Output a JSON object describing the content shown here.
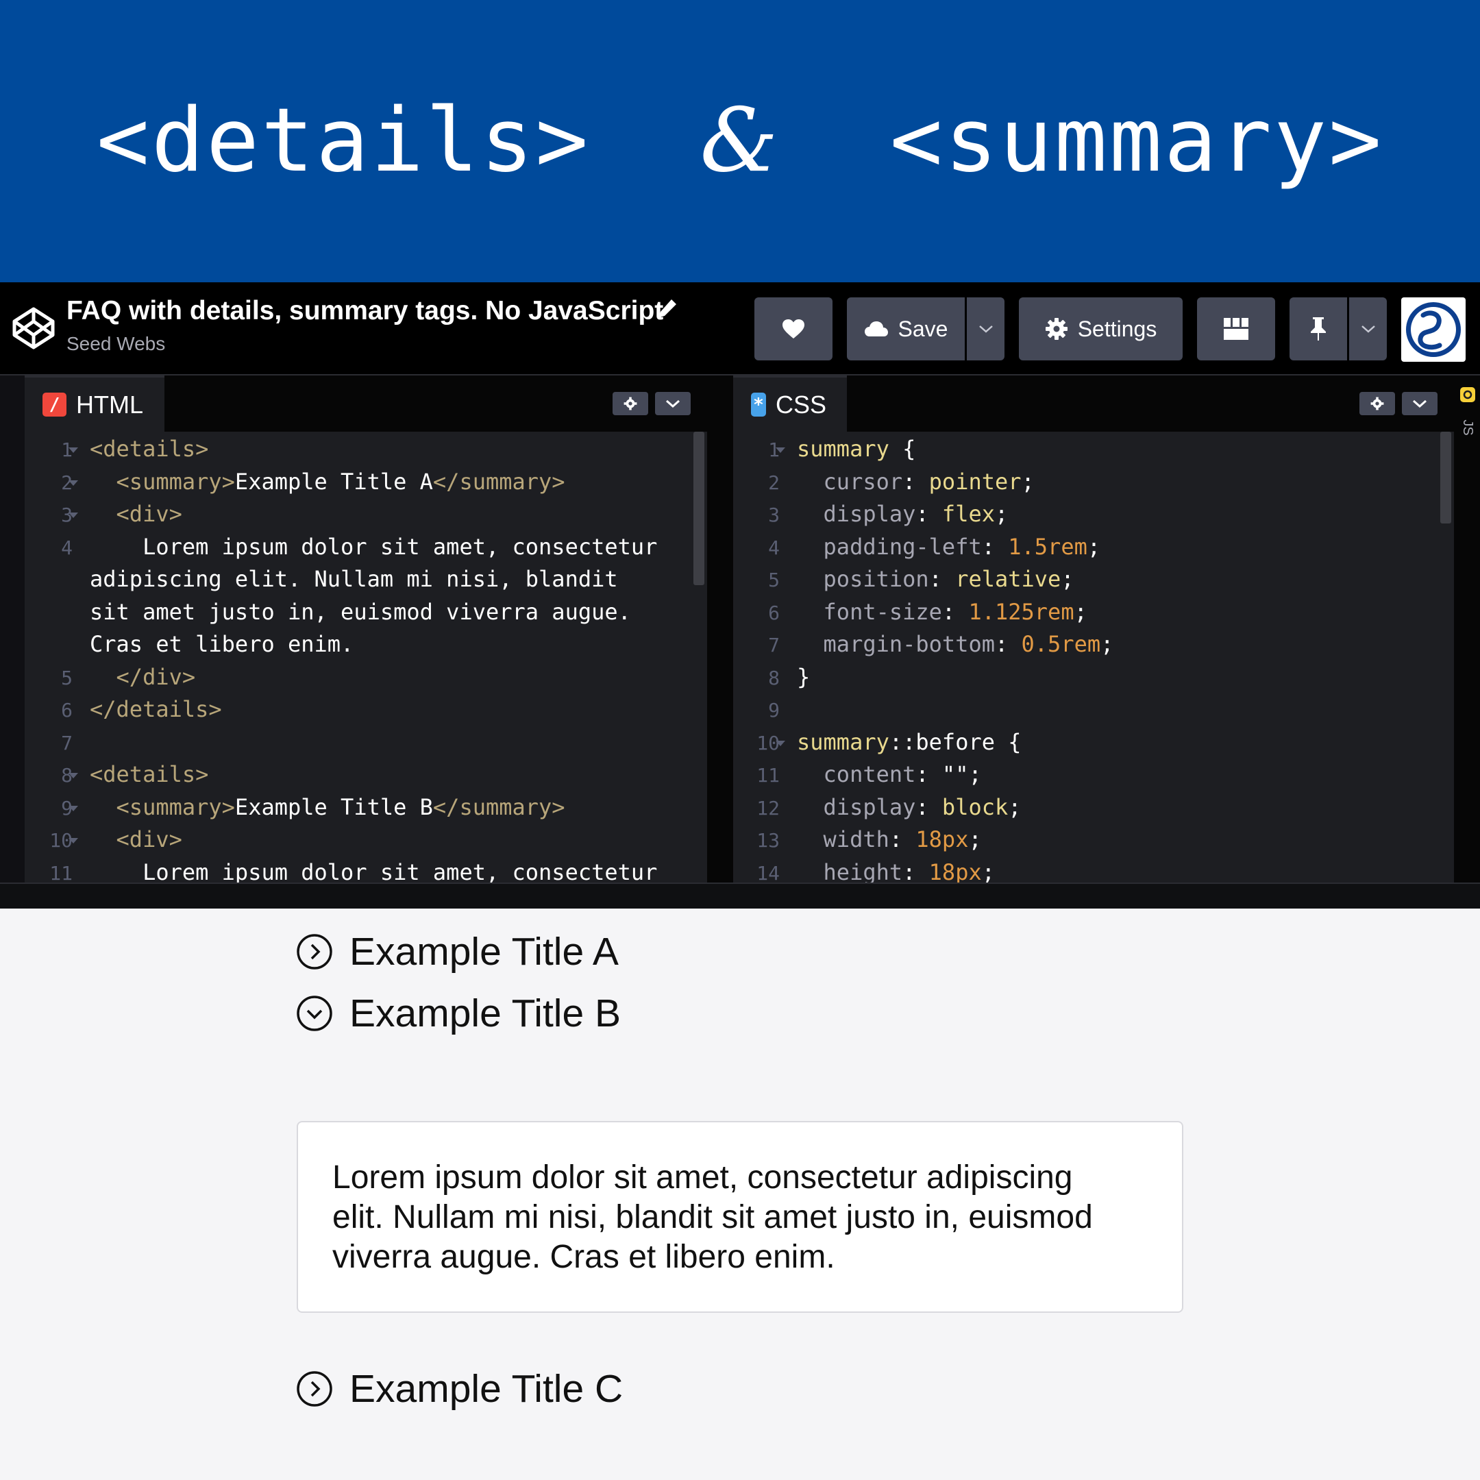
{
  "banner": {
    "left": "<details>",
    "amp": "&",
    "right": "<summary>"
  },
  "header": {
    "title": "FAQ with details, summary tags. No JavaScript",
    "author": "Seed Webs",
    "save_label": "Save",
    "settings_label": "Settings"
  },
  "html_panel": {
    "tab_label": "HTML",
    "lines": [
      {
        "n": "1",
        "fold": true,
        "segs": [
          [
            "c-tag",
            "<details>"
          ]
        ]
      },
      {
        "n": "2",
        "fold": true,
        "segs": [
          [
            "c-tag",
            "  <summary>"
          ],
          [
            "c-txt",
            "Example Title A"
          ],
          [
            "c-tag",
            "</summary>"
          ]
        ]
      },
      {
        "n": "3",
        "fold": true,
        "segs": [
          [
            "c-tag",
            "  <div>"
          ]
        ]
      },
      {
        "n": "4",
        "fold": false,
        "segs": [
          [
            "c-txt",
            "    Lorem ipsum dolor sit amet, consectetur"
          ]
        ]
      },
      {
        "n": "",
        "fold": false,
        "segs": [
          [
            "c-txt",
            "adipiscing elit. Nullam mi nisi, blandit"
          ]
        ]
      },
      {
        "n": "",
        "fold": false,
        "segs": [
          [
            "c-txt",
            "sit amet justo in, euismod viverra augue."
          ]
        ]
      },
      {
        "n": "",
        "fold": false,
        "segs": [
          [
            "c-txt",
            "Cras et libero enim."
          ]
        ]
      },
      {
        "n": "5",
        "fold": false,
        "segs": [
          [
            "c-tag",
            "  </div>"
          ]
        ]
      },
      {
        "n": "6",
        "fold": false,
        "segs": [
          [
            "c-tag",
            "</details>"
          ]
        ]
      },
      {
        "n": "7",
        "fold": false,
        "segs": []
      },
      {
        "n": "8",
        "fold": true,
        "segs": [
          [
            "c-tag",
            "<details>"
          ]
        ]
      },
      {
        "n": "9",
        "fold": true,
        "segs": [
          [
            "c-tag",
            "  <summary>"
          ],
          [
            "c-txt",
            "Example Title B"
          ],
          [
            "c-tag",
            "</summary>"
          ]
        ]
      },
      {
        "n": "10",
        "fold": true,
        "segs": [
          [
            "c-tag",
            "  <div>"
          ]
        ]
      },
      {
        "n": "11",
        "fold": false,
        "segs": [
          [
            "c-txt",
            "    Lorem ipsum dolor sit amet, consectetur"
          ]
        ]
      }
    ]
  },
  "css_panel": {
    "tab_label": "CSS",
    "lines": [
      {
        "n": "1",
        "fold": true,
        "segs": [
          [
            "c-sel",
            "summary"
          ],
          [
            "c-txt",
            " {"
          ]
        ]
      },
      {
        "n": "2",
        "fold": false,
        "segs": [
          [
            "c-prop",
            "  cursor"
          ],
          [
            "c-txt",
            ": "
          ],
          [
            "c-val",
            "pointer"
          ],
          [
            "c-txt",
            ";"
          ]
        ]
      },
      {
        "n": "3",
        "fold": false,
        "segs": [
          [
            "c-prop",
            "  display"
          ],
          [
            "c-txt",
            ": "
          ],
          [
            "c-val",
            "flex"
          ],
          [
            "c-txt",
            ";"
          ]
        ]
      },
      {
        "n": "4",
        "fold": false,
        "segs": [
          [
            "c-prop",
            "  padding-left"
          ],
          [
            "c-txt",
            ": "
          ],
          [
            "c-num",
            "1.5rem"
          ],
          [
            "c-txt",
            ";"
          ]
        ]
      },
      {
        "n": "5",
        "fold": false,
        "segs": [
          [
            "c-prop",
            "  position"
          ],
          [
            "c-txt",
            ": "
          ],
          [
            "c-val",
            "relative"
          ],
          [
            "c-txt",
            ";"
          ]
        ]
      },
      {
        "n": "6",
        "fold": false,
        "segs": [
          [
            "c-prop",
            "  font-size"
          ],
          [
            "c-txt",
            ": "
          ],
          [
            "c-num",
            "1.125rem"
          ],
          [
            "c-txt",
            ";"
          ]
        ]
      },
      {
        "n": "7",
        "fold": false,
        "segs": [
          [
            "c-prop",
            "  margin-bottom"
          ],
          [
            "c-txt",
            ": "
          ],
          [
            "c-num",
            "0.5rem"
          ],
          [
            "c-txt",
            ";"
          ]
        ]
      },
      {
        "n": "8",
        "fold": false,
        "segs": [
          [
            "c-txt",
            "}"
          ]
        ]
      },
      {
        "n": "9",
        "fold": false,
        "segs": []
      },
      {
        "n": "10",
        "fold": true,
        "segs": [
          [
            "c-sel",
            "summary"
          ],
          [
            "c-txt",
            "::before {"
          ]
        ]
      },
      {
        "n": "11",
        "fold": false,
        "segs": [
          [
            "c-prop",
            "  content"
          ],
          [
            "c-txt",
            ": \"\";"
          ]
        ]
      },
      {
        "n": "12",
        "fold": false,
        "segs": [
          [
            "c-prop",
            "  display"
          ],
          [
            "c-txt",
            ": "
          ],
          [
            "c-val",
            "block"
          ],
          [
            "c-txt",
            ";"
          ]
        ]
      },
      {
        "n": "13",
        "fold": false,
        "segs": [
          [
            "c-prop",
            "  width"
          ],
          [
            "c-txt",
            ": "
          ],
          [
            "c-num",
            "18px"
          ],
          [
            "c-txt",
            ";"
          ]
        ]
      },
      {
        "n": "14",
        "fold": false,
        "segs": [
          [
            "c-prop",
            "  height"
          ],
          [
            "c-txt",
            ": "
          ],
          [
            "c-num",
            "18px"
          ],
          [
            "c-txt",
            ";"
          ]
        ]
      }
    ]
  },
  "js_tab_label": "JS",
  "preview": {
    "items": [
      {
        "title": "Example Title A",
        "open": false
      },
      {
        "title": "Example Title B",
        "open": true
      },
      {
        "title": "Example Title C",
        "open": false
      }
    ],
    "open_content": "Lorem ipsum dolor sit amet, consectetur adipiscing elit. Nullam mi nisi, blandit sit amet justo in, euismod viverra augue. Cras et libero enim."
  },
  "colors": {
    "banner": "#004a9b",
    "header": "#000000",
    "editor": "#1d1e22",
    "button": "#444857",
    "preview_bg": "#f5f5f7"
  }
}
